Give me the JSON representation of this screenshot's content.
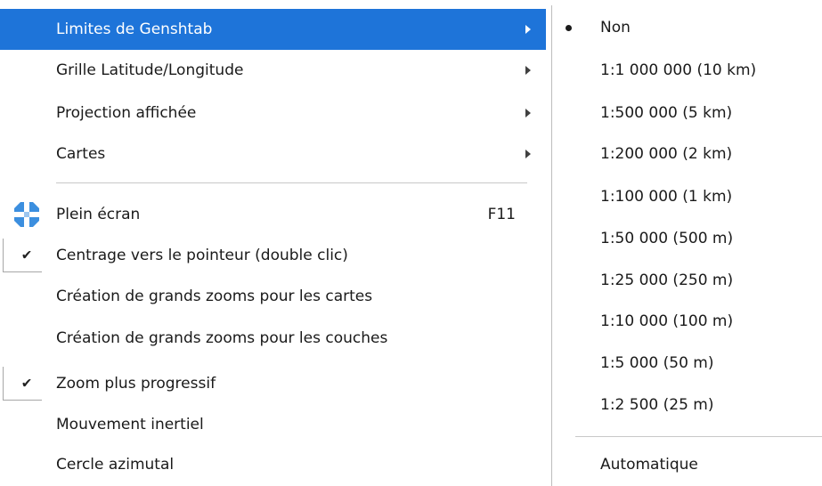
{
  "main_menu": {
    "items": [
      {
        "label": "Limites de Genshtab",
        "submenu": true,
        "highlighted": true
      },
      {
        "label": "Grille Latitude/Longitude",
        "submenu": true
      },
      {
        "label": "Projection affichée",
        "submenu": true
      },
      {
        "label": "Cartes",
        "submenu": true
      },
      {
        "label": "Plein écran",
        "shortcut": "F11",
        "icon": "fullscreen-icon"
      },
      {
        "label": "Centrage vers le pointeur (double clic)",
        "checked": true
      },
      {
        "label": "Création de grands zooms pour les cartes"
      },
      {
        "label": "Création de grands zooms pour les couches"
      },
      {
        "label": "Zoom plus progressif",
        "checked": true
      },
      {
        "label": "Mouvement inertiel"
      },
      {
        "label": "Cercle azimutal"
      }
    ]
  },
  "submenu": {
    "items": [
      {
        "label": "Non",
        "selected": true
      },
      {
        "label": "1:1 000 000 (10 km)"
      },
      {
        "label": "1:500 000 (5 km)"
      },
      {
        "label": "1:200 000 (2 km)"
      },
      {
        "label": "1:100 000 (1 km)"
      },
      {
        "label": "1:50 000 (500 m)"
      },
      {
        "label": "1:25 000 (250 m)"
      },
      {
        "label": "1:10 000 (100 m)"
      },
      {
        "label": "1:5 000 (50 m)"
      },
      {
        "label": "1:2 500 (25 m)"
      },
      {
        "label": "Automatique"
      }
    ]
  },
  "colors": {
    "highlight": "#1e74d9",
    "highlight_text": "#ffffff",
    "text": "#1a1a1a",
    "separator": "#c8c8c8",
    "icon_blue": "#3c8fdf"
  }
}
